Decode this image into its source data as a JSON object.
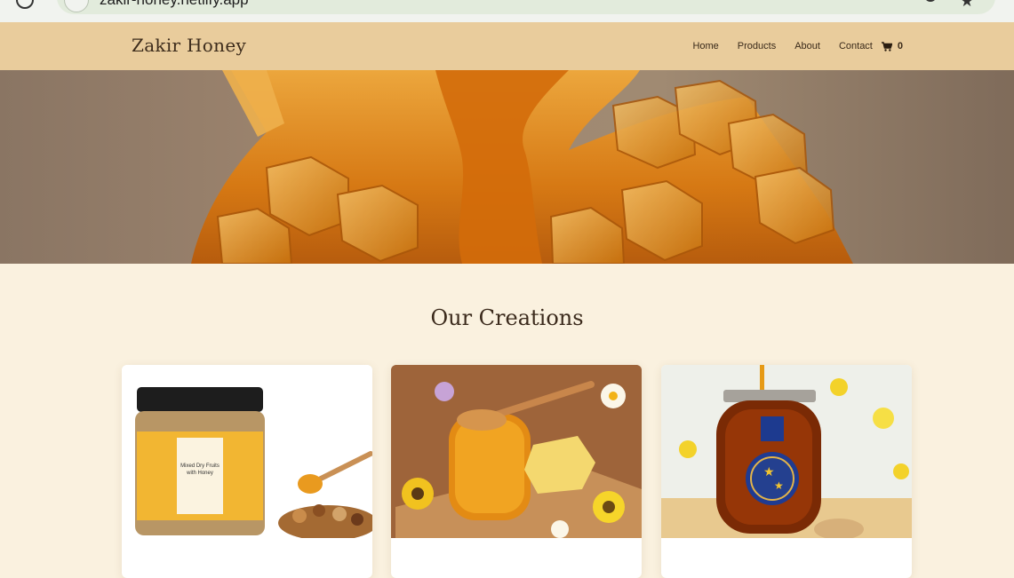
{
  "browser": {
    "url": "zakir-honey.netlify.app"
  },
  "header": {
    "brand": "Zakir Honey",
    "nav": [
      "Home",
      "Products",
      "About",
      "Contact"
    ],
    "cart_count": "0"
  },
  "hero": {
    "image": "honey-dripping-on-honeycomb"
  },
  "section": {
    "title": "Our Creations"
  },
  "products": [
    {
      "image": "mixed-dry-fruits-with-honey-jar",
      "jar_label": "Mixed Dry Fruits with Honey"
    },
    {
      "image": "honey-jar-with-dipper-and-flowers"
    },
    {
      "image": "dark-honey-jar-with-blue-label"
    }
  ],
  "colors": {
    "header_bg": "#e9cc9c",
    "page_bg": "#faf1df",
    "text_dark": "#3b2a1c",
    "honey": "#e08f12"
  }
}
